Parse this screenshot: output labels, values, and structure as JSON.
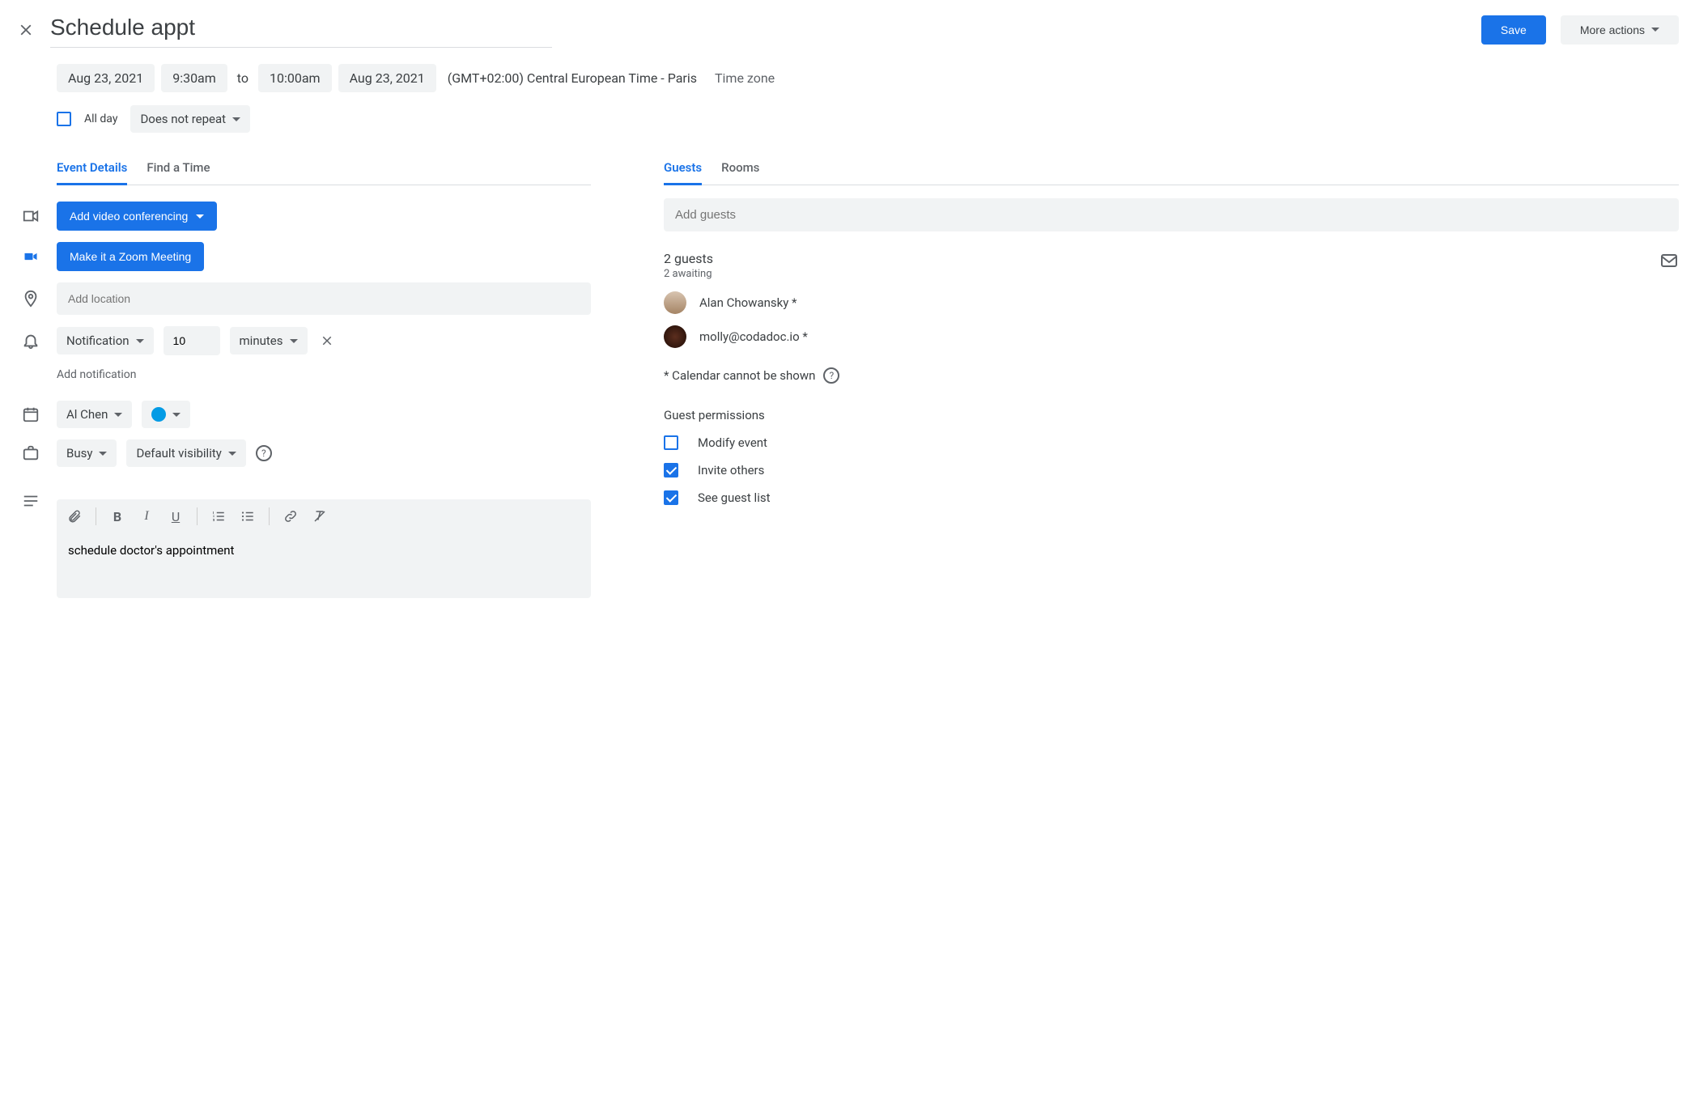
{
  "header": {
    "title": "Schedule appt",
    "save": "Save",
    "more_actions": "More actions"
  },
  "datetime": {
    "start_date": "Aug 23, 2021",
    "start_time": "9:30am",
    "to": "to",
    "end_time": "10:00am",
    "end_date": "Aug 23, 2021",
    "tz_text": "(GMT+02:00) Central European Time - Paris",
    "tz_link": "Time zone"
  },
  "allday": {
    "label": "All day",
    "repeat": "Does not repeat"
  },
  "tabs_left": {
    "details": "Event Details",
    "find": "Find a Time"
  },
  "conferencing": {
    "add_video": "Add video conferencing",
    "zoom": "Make it a Zoom Meeting"
  },
  "location": {
    "placeholder": "Add location"
  },
  "notification": {
    "type": "Notification",
    "value": "10",
    "unit": "minutes",
    "add": "Add notification"
  },
  "calendar": {
    "owner": "Al Chen"
  },
  "visibility": {
    "status": "Busy",
    "vis": "Default visibility"
  },
  "description": {
    "text": "schedule doctor's appointment"
  },
  "tabs_right": {
    "guests": "Guests",
    "rooms": "Rooms"
  },
  "guests": {
    "placeholder": "Add guests",
    "count": "2 guests",
    "awaiting": "2 awaiting",
    "list": [
      {
        "name": "Alan Chowansky *"
      },
      {
        "name": "molly@codadoc.io *"
      }
    ],
    "cannot_shown": "* Calendar cannot be shown"
  },
  "permissions": {
    "title": "Guest permissions",
    "modify": "Modify event",
    "invite": "Invite others",
    "see_list": "See guest list"
  }
}
